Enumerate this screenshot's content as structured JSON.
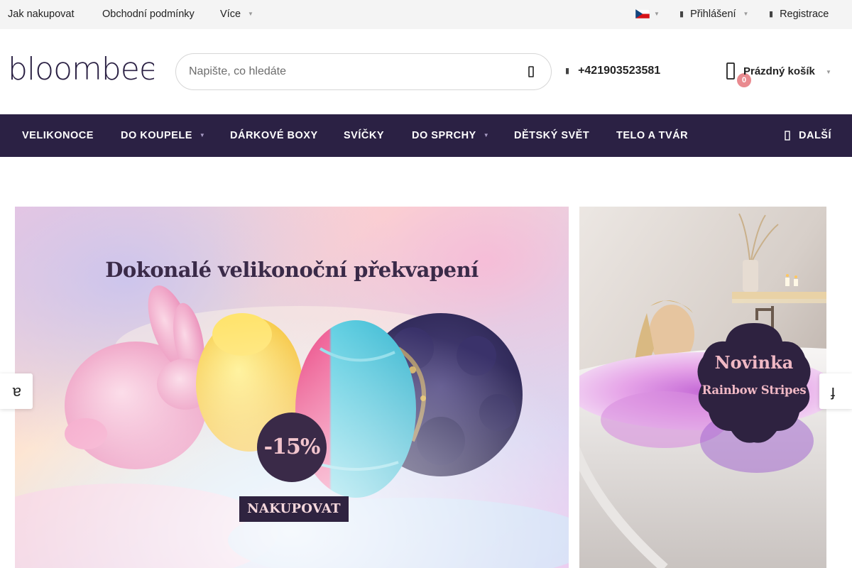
{
  "topbar": {
    "links": [
      "Jak nakupovat",
      "Obchodní podmínky",
      "Více"
    ],
    "language": "czech-flag-icon",
    "login": "Přihlášení",
    "register": "Registrace"
  },
  "header": {
    "logo_text": "bloombee",
    "search_placeholder": "Napište, co hledáte",
    "phone": "+421903523581",
    "cart_label": "Prázdný košík",
    "cart_count": "0"
  },
  "nav": {
    "items": [
      "VELIKONOCE",
      "DO KOUPELE",
      "DÁRKOVÉ BOXY",
      "SVÍČKY",
      "DO SPRCHY",
      "DĚTSKÝ SVĚT",
      "TELO A TVÁR"
    ],
    "more": "DALŠÍ"
  },
  "banners": {
    "main": {
      "title": "Dokonalé velikonoční překvapení",
      "discount": "-15%",
      "button": "NAKUPOVAT"
    },
    "side": {
      "title": "Novinka",
      "subtitle": "Rainbow Stripes"
    }
  },
  "slider": {
    "prev_glyph": "ɐ",
    "next_glyph": "ɟ"
  },
  "colors": {
    "nav_bg": "#2b2144",
    "badge": "#e98a8f",
    "brand_dark": "#3a2a48",
    "brand_pink": "#f0b8c4"
  }
}
